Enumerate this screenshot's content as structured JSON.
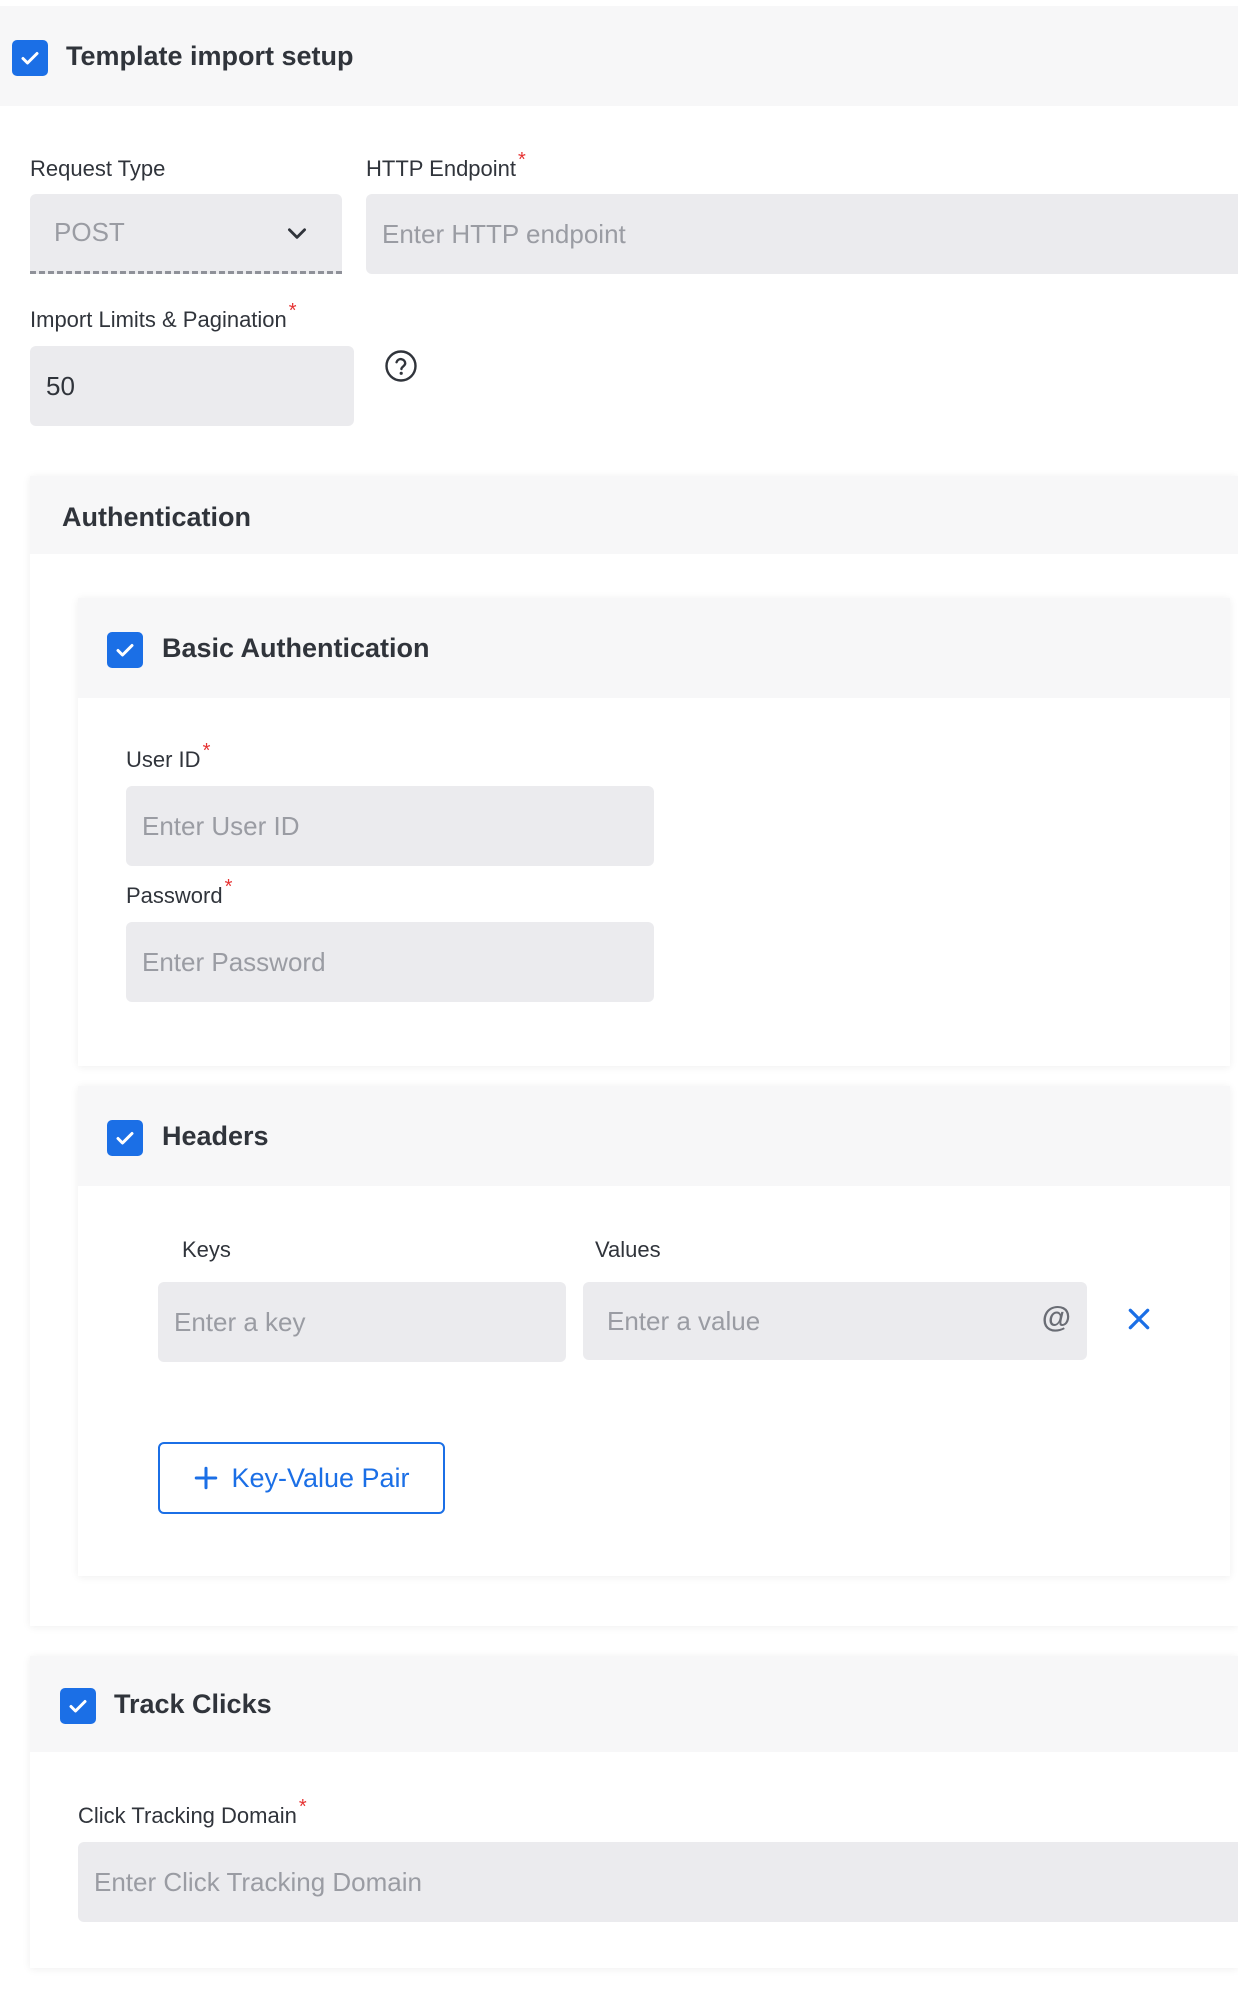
{
  "template_import": {
    "title": "Template import setup",
    "checked": true,
    "request_type": {
      "label": "Request Type",
      "value": "POST"
    },
    "http_endpoint": {
      "label": "HTTP Endpoint",
      "required_mark": "*",
      "placeholder": "Enter HTTP endpoint"
    },
    "import_limits": {
      "label": "Import Limits & Pagination",
      "required_mark": "*",
      "value": "50",
      "help_icon": "question-circle-icon"
    }
  },
  "authentication": {
    "title": "Authentication",
    "basic_auth": {
      "title": "Basic Authentication",
      "checked": true,
      "user_id": {
        "label": "User ID",
        "required_mark": "*",
        "placeholder": "Enter User ID"
      },
      "password": {
        "label": "Password",
        "required_mark": "*",
        "placeholder": "Enter Password"
      }
    },
    "headers": {
      "title": "Headers",
      "checked": true,
      "keys_label": "Keys",
      "values_label": "Values",
      "key_placeholder": "Enter a key",
      "value_placeholder": "Enter a value",
      "at_symbol": "@",
      "remove_icon": "close-icon",
      "add_button_label": "Key-Value Pair"
    }
  },
  "track_clicks": {
    "title": "Track Clicks",
    "checked": true,
    "domain": {
      "label": "Click Tracking Domain",
      "required_mark": "*",
      "placeholder": "Enter Click Tracking Domain"
    }
  },
  "colors": {
    "accent": "#1b6fe6",
    "required": "#e63232",
    "input_bg": "#ebebee",
    "section_bg": "#f7f7f8"
  }
}
